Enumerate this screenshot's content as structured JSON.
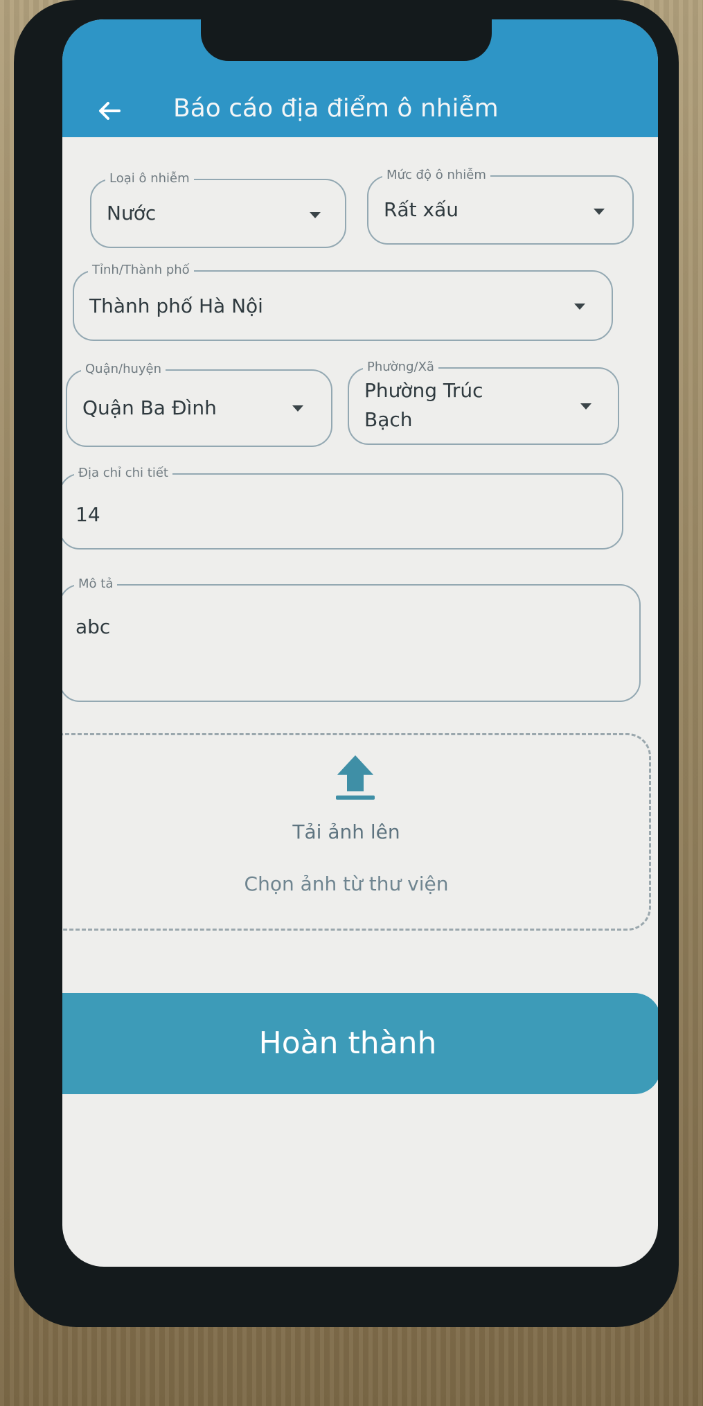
{
  "header": {
    "title": "Báo cáo địa điểm ô nhiễm",
    "back_icon": "arrow-left-icon"
  },
  "form": {
    "pollution_type": {
      "label": "Loại ô nhiễm",
      "value": "Nước"
    },
    "pollution_level": {
      "label": "Mức độ ô nhiễm",
      "value": "Rất xấu"
    },
    "province": {
      "label": "Tỉnh/Thành phố",
      "value": "Thành phố Hà Nội"
    },
    "district": {
      "label": "Quận/huyện",
      "value": "Quận Ba Đình"
    },
    "ward": {
      "label": "Phường/Xã",
      "value_line1": "Phường Trúc",
      "value_line2": "Bạch"
    },
    "address": {
      "label": "Địa chỉ chi tiết",
      "value": "14"
    },
    "description": {
      "label": "Mô tả",
      "value": "abc"
    }
  },
  "upload": {
    "title": "Tải ảnh lên",
    "subtitle": "Chọn ảnh từ thư viện",
    "icon": "upload-icon"
  },
  "submit_label": "Hoàn thành",
  "colors": {
    "appbar": "#2e95c6",
    "submit": "#3d9bb8",
    "border": "#93a8b2"
  }
}
